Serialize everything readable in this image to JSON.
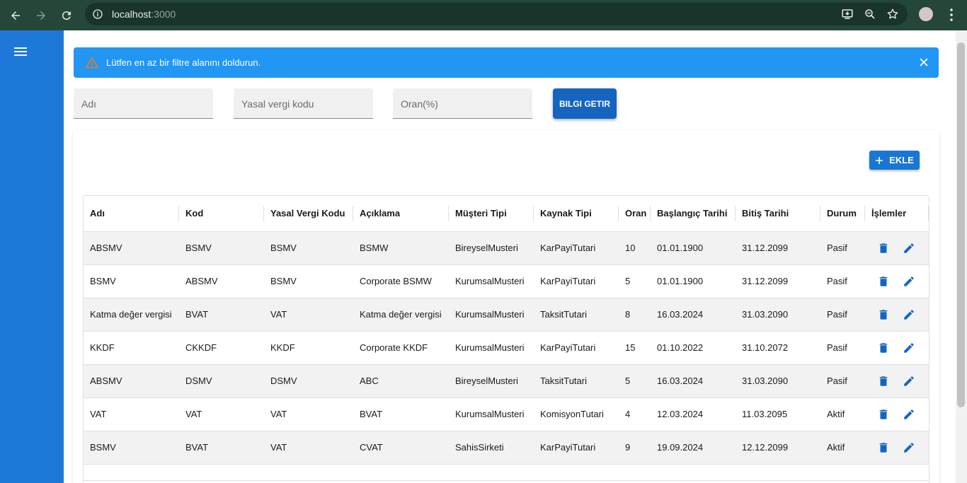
{
  "browser": {
    "url_host": "localhost",
    "url_port": ":3000"
  },
  "alert": {
    "message": "Lütfen en az bir filtre alanını doldurun."
  },
  "filters": {
    "name_placeholder": "Adı",
    "tax_code_placeholder": "Yasal vergi kodu",
    "rate_placeholder": "Oran(%)",
    "fetch_button": "BILGI GETIR"
  },
  "toolbar": {
    "add_button": "EKLE"
  },
  "table": {
    "columns": [
      "Adı",
      "Kod",
      "Yasal Vergi Kodu",
      "Açıklama",
      "Müşteri Tipi",
      "Kaynak Tipi",
      "Oran",
      "Başlangıç Tarihi",
      "Bitiş Tarihi",
      "Durum",
      "İşlemler"
    ],
    "rows": [
      [
        "ABSMV",
        "BSMV",
        "BSMV",
        "BSMW",
        "BireyselMusteri",
        "KarPayiTutari",
        "10",
        "01.01.1900",
        "31.12.2099",
        "Pasif"
      ],
      [
        "BSMV",
        "ABSMV",
        "BSMV",
        "Corporate BSMW",
        "KurumsalMusteri",
        "KarPayiTutari",
        "5",
        "01.01.1900",
        "31.12.2099",
        "Pasif"
      ],
      [
        "Katma değer vergisi",
        "BVAT",
        "VAT",
        "Katma değer vergisi",
        "KurumsalMusteri",
        "TaksitTutari",
        "8",
        "16.03.2024",
        "31.03.2090",
        "Pasif"
      ],
      [
        "KKDF",
        "CKKDF",
        "KKDF",
        "Corporate KKDF",
        "KurumsalMusteri",
        "KarPayiTutari",
        "15",
        "01.10.2022",
        "31.10.2072",
        "Pasif"
      ],
      [
        "ABSMV",
        "DSMV",
        "DSMV",
        "ABC",
        "BireyselMusteri",
        "TaksitTutari",
        "5",
        "16.03.2024",
        "31.03.2090",
        "Pasif"
      ],
      [
        "VAT",
        "VAT",
        "VAT",
        "BVAT",
        "KurumsalMusteri",
        "KomisyonTutari",
        "4",
        "12.03.2024",
        "11.03.2095",
        "Aktif"
      ],
      [
        "BSMV",
        "BVAT",
        "VAT",
        "CVAT",
        "SahisSirketi",
        "KarPayiTutari",
        "9",
        "19.09.2024",
        "12.12.2099",
        "Aktif"
      ]
    ]
  },
  "colors": {
    "sidebar": "#1e78d8",
    "alert": "#2196f3",
    "primary_button": "#1565c0",
    "action_icon": "#1565c0"
  }
}
